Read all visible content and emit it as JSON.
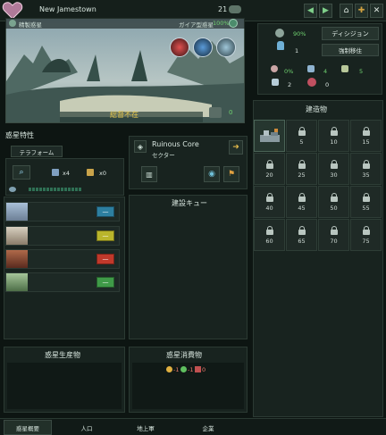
{
  "header": {
    "planet_name": "New Jamestown",
    "planet_size": "21",
    "planet_class": "精製惑星",
    "habitability_label": "ガイア型惑星",
    "habitability_value": "100%",
    "governor": "総督不在",
    "stability_value": "0"
  },
  "right_top": {
    "stability": "90%",
    "pop": "1",
    "division_button": "ディシジョン",
    "resettle_button": "強制移住",
    "stats": {
      "s1": "0%",
      "s2": "4",
      "s3": "5",
      "s4": "2",
      "s5": "0"
    }
  },
  "planet_traits": {
    "title": "惑星特性",
    "terraform_tab": "テラフォーム",
    "count_a": "x4",
    "count_b": "x0"
  },
  "sector": {
    "name": "Ruinous Core",
    "type": "セクター"
  },
  "construction_queue": {
    "title": "建設キュー"
  },
  "buildings": {
    "title": "建造物",
    "slots": [
      "5",
      "10",
      "15",
      "20",
      "25",
      "30",
      "35",
      "40",
      "45",
      "50",
      "55",
      "60",
      "65",
      "70",
      "75"
    ]
  },
  "pop_rows": [
    {
      "chip": "—",
      "color": "#2d7fa0"
    },
    {
      "chip": "—",
      "color": "#b9b52b"
    },
    {
      "chip": "—",
      "color": "#c0392b"
    },
    {
      "chip": "—",
      "color": "#3f9a48"
    }
  ],
  "production": {
    "title": "惑星生産物"
  },
  "upkeep": {
    "title": "惑星消費物",
    "energy": "-1",
    "food": "-1",
    "minerals": "0"
  },
  "tabs": {
    "t1": "惑星概要",
    "t2": "人口",
    "t3": "地上軍",
    "t4": "企業"
  }
}
